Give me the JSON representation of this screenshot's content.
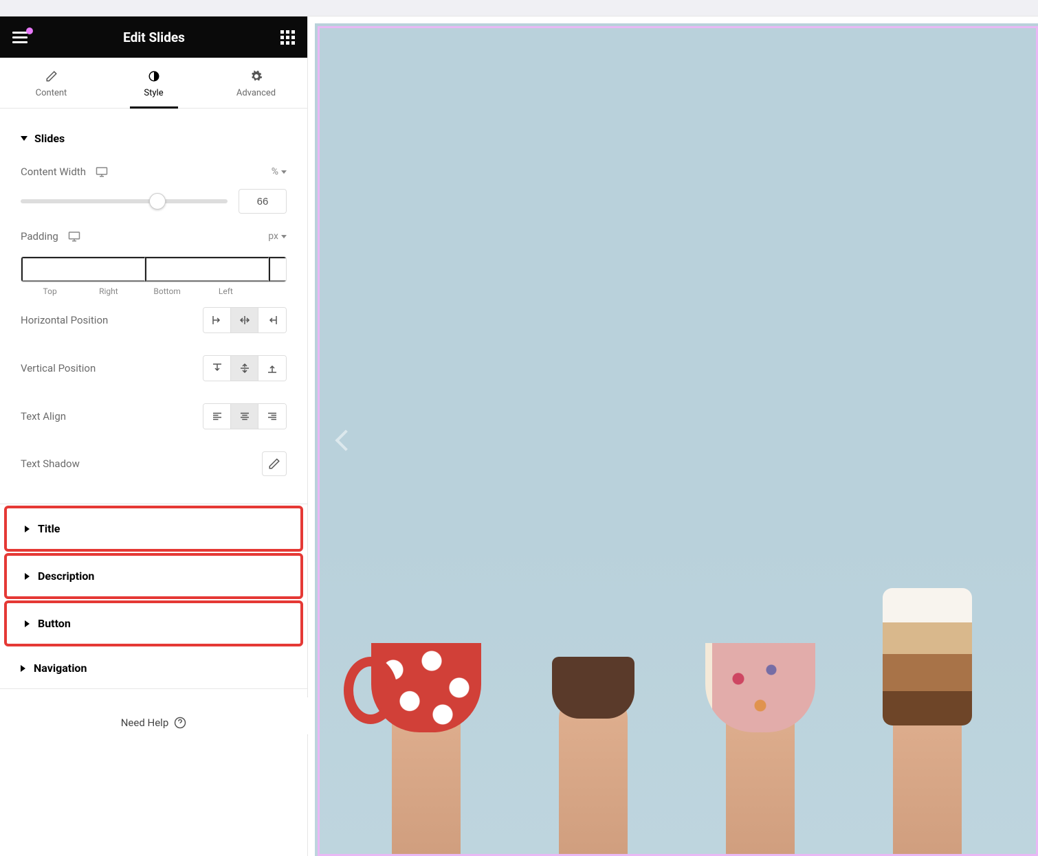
{
  "header": {
    "title": "Edit Slides"
  },
  "tabs": [
    {
      "label": "Content"
    },
    {
      "label": "Style"
    },
    {
      "label": "Advanced"
    }
  ],
  "active_tab": "Style",
  "slides": {
    "section_label": "Slides",
    "content_width": {
      "label": "Content Width",
      "unit": "%",
      "value": "66"
    },
    "padding": {
      "label": "Padding",
      "unit": "px",
      "sides": {
        "top": "Top",
        "right": "Right",
        "bottom": "Bottom",
        "left": "Left"
      }
    },
    "horizontal_position": {
      "label": "Horizontal Position"
    },
    "vertical_position": {
      "label": "Vertical Position"
    },
    "text_align": {
      "label": "Text Align"
    },
    "text_shadow": {
      "label": "Text Shadow"
    }
  },
  "accordions": {
    "title": "Title",
    "description": "Description",
    "button": "Button",
    "navigation": "Navigation"
  },
  "footer": {
    "help": "Need Help"
  }
}
